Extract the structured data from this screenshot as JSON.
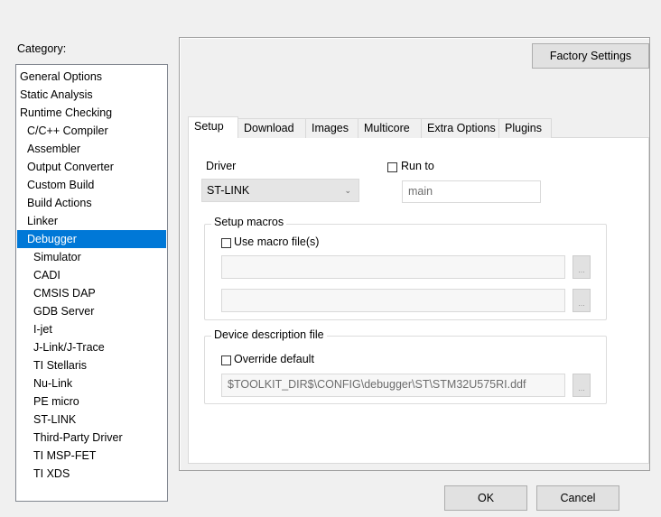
{
  "category": {
    "label": "Category:",
    "items": [
      {
        "label": "General Options",
        "indent": 0
      },
      {
        "label": "Static Analysis",
        "indent": 0
      },
      {
        "label": "Runtime Checking",
        "indent": 0
      },
      {
        "label": "C/C++ Compiler",
        "indent": 1
      },
      {
        "label": "Assembler",
        "indent": 1
      },
      {
        "label": "Output Converter",
        "indent": 1
      },
      {
        "label": "Custom Build",
        "indent": 1
      },
      {
        "label": "Build Actions",
        "indent": 1
      },
      {
        "label": "Linker",
        "indent": 1
      },
      {
        "label": "Debugger",
        "indent": 1,
        "selected": true
      },
      {
        "label": "Simulator",
        "indent": 2
      },
      {
        "label": "CADI",
        "indent": 2
      },
      {
        "label": "CMSIS DAP",
        "indent": 2
      },
      {
        "label": "GDB Server",
        "indent": 2
      },
      {
        "label": "I-jet",
        "indent": 2
      },
      {
        "label": "J-Link/J-Trace",
        "indent": 2
      },
      {
        "label": "TI Stellaris",
        "indent": 2
      },
      {
        "label": "Nu-Link",
        "indent": 2
      },
      {
        "label": "PE micro",
        "indent": 2
      },
      {
        "label": "ST-LINK",
        "indent": 2
      },
      {
        "label": "Third-Party Driver",
        "indent": 2
      },
      {
        "label": "TI MSP-FET",
        "indent": 2
      },
      {
        "label": "TI XDS",
        "indent": 2
      }
    ]
  },
  "factory_settings_label": "Factory Settings",
  "tabs": [
    "Setup",
    "Download",
    "Images",
    "Multicore",
    "Extra Options",
    "Plugins"
  ],
  "active_tab": "Setup",
  "setup": {
    "driver_label": "Driver",
    "driver_value": "ST-LINK",
    "run_to_label": "Run to",
    "run_to_value": "main",
    "setup_macros_label": "Setup macros",
    "use_macro_label": "Use macro file(s)",
    "macro_file_1": "",
    "macro_file_2": "",
    "browse_label": "...",
    "device_desc_label": "Device description file",
    "override_label": "Override default",
    "device_desc_value": "$TOOLKIT_DIR$\\CONFIG\\debugger\\ST\\STM32U575RI.ddf"
  },
  "buttons": {
    "ok": "OK",
    "cancel": "Cancel"
  },
  "colors": {
    "selection": "#0078d7",
    "background": "#f0f0f0"
  }
}
